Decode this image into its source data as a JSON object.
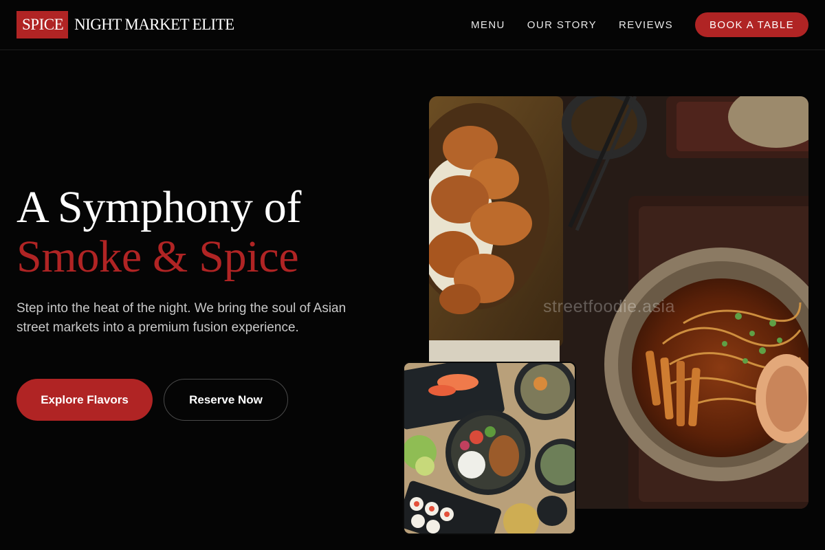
{
  "brand": {
    "box_text": "SPICE",
    "name_text": "NIGHT MARKET ELITE"
  },
  "nav": {
    "links": [
      "MENU",
      "OUR STORY",
      "REVIEWS"
    ],
    "cta_label": "BOOK A TABLE"
  },
  "hero": {
    "title_line1": "A Symphony of",
    "title_line2": "Smoke & Spice",
    "description": "Step into the heat of the night. We bring the soul of Asian street markets into a premium fusion experience.",
    "primary_button": "Explore Flavors",
    "secondary_button": "Reserve Now"
  },
  "images": {
    "main_photo": {
      "subject": "ramen-and-fried-chicken-photo",
      "watermark": "streetfoodie.asia"
    },
    "secondary_photo": {
      "subject": "sashimi-poke-sushi-spread-photo"
    }
  },
  "colors": {
    "accent": "#b02424",
    "background": "#050505",
    "text": "#ffffff",
    "muted_text": "#c9c9c9"
  }
}
